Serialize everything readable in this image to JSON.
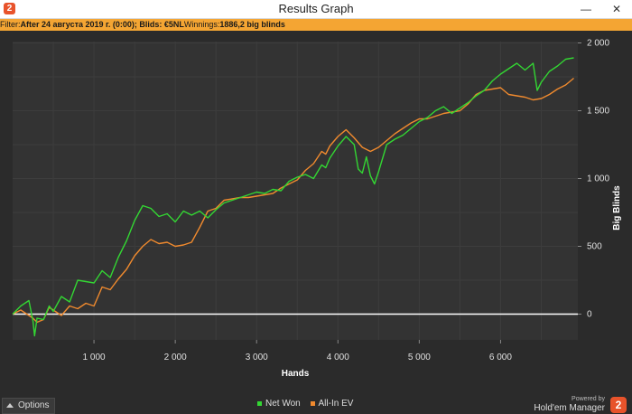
{
  "window": {
    "title": "Results Graph",
    "app_icon_glyph": "2",
    "minimize_glyph": "—",
    "close_glyph": "✕"
  },
  "filter": {
    "prefix": "Filter: ",
    "text": "After 24 августа 2019 г. (0:00); Blids: €5NL",
    "winnings_label": " Winnings: ",
    "winnings_value": "1886,2 big blinds"
  },
  "footer": {
    "options_label": "Options",
    "powered_by": "Powered by",
    "product": "Hold'em Manager",
    "logo_glyph": "2"
  },
  "colors": {
    "net_won": "#33d633",
    "all_in_ev": "#f08a2e",
    "zero_line": "#ffffff",
    "background": "#2b2b2b",
    "filter_bar": "#f4a533"
  },
  "chart_data": {
    "type": "line",
    "xlabel": "Hands",
    "ylabel": "Big Blinds",
    "xlim": [
      0,
      6950
    ],
    "ylim": [
      -190,
      2010
    ],
    "x_ticks": [
      {
        "value": 1000,
        "label": "1 000"
      },
      {
        "value": 2000,
        "label": "2 000"
      },
      {
        "value": 3000,
        "label": "3 000"
      },
      {
        "value": 4000,
        "label": "4 000"
      },
      {
        "value": 5000,
        "label": "5 000"
      },
      {
        "value": 6000,
        "label": "6 000"
      }
    ],
    "y_ticks": [
      {
        "value": 0,
        "label": "0"
      },
      {
        "value": 500,
        "label": "500"
      },
      {
        "value": 1000,
        "label": "1 000"
      },
      {
        "value": 1500,
        "label": "1 500"
      },
      {
        "value": 2000,
        "label": "2 000"
      }
    ],
    "grid": true,
    "legend_position": "bottom-center",
    "series": [
      {
        "name": "Net Won",
        "color": "#33d633",
        "points": [
          [
            0,
            0
          ],
          [
            100,
            60
          ],
          [
            200,
            100
          ],
          [
            250,
            -50
          ],
          [
            270,
            -160
          ],
          [
            300,
            -30
          ],
          [
            380,
            -40
          ],
          [
            450,
            60
          ],
          [
            500,
            20
          ],
          [
            600,
            130
          ],
          [
            700,
            90
          ],
          [
            800,
            250
          ],
          [
            900,
            240
          ],
          [
            1000,
            230
          ],
          [
            1100,
            320
          ],
          [
            1200,
            270
          ],
          [
            1300,
            420
          ],
          [
            1400,
            540
          ],
          [
            1500,
            690
          ],
          [
            1600,
            800
          ],
          [
            1700,
            780
          ],
          [
            1800,
            720
          ],
          [
            1900,
            740
          ],
          [
            2000,
            680
          ],
          [
            2100,
            760
          ],
          [
            2200,
            730
          ],
          [
            2300,
            760
          ],
          [
            2400,
            710
          ],
          [
            2500,
            770
          ],
          [
            2600,
            820
          ],
          [
            2700,
            840
          ],
          [
            2800,
            860
          ],
          [
            2900,
            880
          ],
          [
            3000,
            900
          ],
          [
            3100,
            890
          ],
          [
            3200,
            920
          ],
          [
            3300,
            910
          ],
          [
            3400,
            980
          ],
          [
            3500,
            1010
          ],
          [
            3600,
            1030
          ],
          [
            3700,
            1000
          ],
          [
            3800,
            1100
          ],
          [
            3850,
            1080
          ],
          [
            3900,
            1150
          ],
          [
            4000,
            1240
          ],
          [
            4100,
            1310
          ],
          [
            4200,
            1250
          ],
          [
            4250,
            1070
          ],
          [
            4300,
            1040
          ],
          [
            4350,
            1160
          ],
          [
            4400,
            1020
          ],
          [
            4450,
            960
          ],
          [
            4500,
            1050
          ],
          [
            4550,
            1150
          ],
          [
            4600,
            1250
          ],
          [
            4700,
            1290
          ],
          [
            4800,
            1320
          ],
          [
            4900,
            1370
          ],
          [
            5000,
            1420
          ],
          [
            5100,
            1450
          ],
          [
            5200,
            1500
          ],
          [
            5300,
            1530
          ],
          [
            5400,
            1480
          ],
          [
            5500,
            1520
          ],
          [
            5600,
            1560
          ],
          [
            5700,
            1610
          ],
          [
            5800,
            1650
          ],
          [
            5900,
            1720
          ],
          [
            6000,
            1770
          ],
          [
            6100,
            1810
          ],
          [
            6200,
            1850
          ],
          [
            6300,
            1800
          ],
          [
            6400,
            1850
          ],
          [
            6450,
            1650
          ],
          [
            6500,
            1710
          ],
          [
            6600,
            1790
          ],
          [
            6700,
            1830
          ],
          [
            6800,
            1880
          ],
          [
            6900,
            1890
          ]
        ]
      },
      {
        "name": "All-In EV",
        "color": "#f08a2e",
        "points": [
          [
            0,
            0
          ],
          [
            100,
            30
          ],
          [
            200,
            -10
          ],
          [
            250,
            -30
          ],
          [
            300,
            -60
          ],
          [
            380,
            -40
          ],
          [
            450,
            50
          ],
          [
            500,
            30
          ],
          [
            600,
            -10
          ],
          [
            700,
            60
          ],
          [
            800,
            40
          ],
          [
            900,
            80
          ],
          [
            1000,
            60
          ],
          [
            1100,
            200
          ],
          [
            1200,
            180
          ],
          [
            1300,
            260
          ],
          [
            1400,
            330
          ],
          [
            1500,
            430
          ],
          [
            1600,
            500
          ],
          [
            1700,
            550
          ],
          [
            1800,
            520
          ],
          [
            1900,
            530
          ],
          [
            2000,
            500
          ],
          [
            2100,
            510
          ],
          [
            2200,
            530
          ],
          [
            2300,
            640
          ],
          [
            2400,
            760
          ],
          [
            2500,
            780
          ],
          [
            2600,
            840
          ],
          [
            2700,
            850
          ],
          [
            2800,
            860
          ],
          [
            2900,
            860
          ],
          [
            3000,
            870
          ],
          [
            3100,
            880
          ],
          [
            3200,
            890
          ],
          [
            3300,
            930
          ],
          [
            3400,
            960
          ],
          [
            3500,
            990
          ],
          [
            3600,
            1060
          ],
          [
            3700,
            1110
          ],
          [
            3800,
            1200
          ],
          [
            3850,
            1180
          ],
          [
            3900,
            1240
          ],
          [
            4000,
            1310
          ],
          [
            4100,
            1360
          ],
          [
            4200,
            1300
          ],
          [
            4300,
            1230
          ],
          [
            4400,
            1200
          ],
          [
            4500,
            1230
          ],
          [
            4600,
            1280
          ],
          [
            4700,
            1330
          ],
          [
            4800,
            1370
          ],
          [
            4900,
            1410
          ],
          [
            5000,
            1440
          ],
          [
            5100,
            1440
          ],
          [
            5200,
            1460
          ],
          [
            5300,
            1480
          ],
          [
            5400,
            1490
          ],
          [
            5500,
            1500
          ],
          [
            5600,
            1550
          ],
          [
            5700,
            1620
          ],
          [
            5800,
            1650
          ],
          [
            5900,
            1660
          ],
          [
            6000,
            1670
          ],
          [
            6100,
            1620
          ],
          [
            6200,
            1610
          ],
          [
            6300,
            1600
          ],
          [
            6400,
            1580
          ],
          [
            6500,
            1590
          ],
          [
            6600,
            1620
          ],
          [
            6700,
            1660
          ],
          [
            6800,
            1690
          ],
          [
            6900,
            1740
          ]
        ]
      }
    ]
  }
}
